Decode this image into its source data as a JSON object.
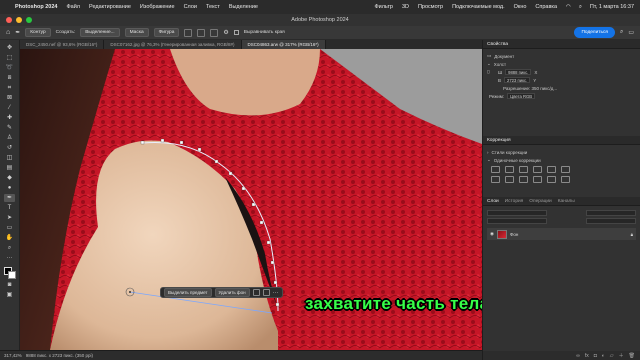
{
  "menubar": {
    "app": "Photoshop 2024",
    "items": [
      "Файл",
      "Редактирование",
      "Изображение",
      "Слои",
      "Текст",
      "Выделение",
      "Фильтр",
      "3D",
      "Просмотр",
      "Подключаемые мод.",
      "Окно",
      "Справка"
    ],
    "clock": "Пт, 1 марта  16:37"
  },
  "window": {
    "title": "Adobe Photoshop 2024"
  },
  "options": {
    "mode": "Контур",
    "make": "Создать:",
    "selection": "Выделение...",
    "mask": "Маска",
    "shape": "Фигура",
    "align": "Выравнивать края",
    "share": "Поделиться"
  },
  "tabs": [
    "DSC_2450.nef @ 93,6% (RGB/16*)",
    "DSC07162.jpg @ 76,3% (Генерированная заливка, RGB/8#)",
    "DSC04863.arw @ 317% (RGB/16*)"
  ],
  "canvas": {
    "caption": "захватите часть тела"
  },
  "context_bar": {
    "select_subject": "Выделить предмет",
    "remove_bg": "Удалить фон"
  },
  "status": {
    "zoom": "317,42%",
    "dims": "9888 пикс. x 2723 пикс. (350 ppi)"
  },
  "panel": {
    "properties": "Свойства",
    "document": "Документ",
    "canvas": "Холст",
    "w_label": "Ш",
    "w_value": "9888 пикс.",
    "h_label": "В",
    "h_value": "2723 пикс.",
    "resolution": "Разрешение: 350 пикс/д...",
    "mode_label": "Режим:",
    "mode_value": "Цвета RGB",
    "corrections": "Коррекция",
    "corr_styles": "Стили коррекции",
    "single_corr": "Одиночные коррекции",
    "layer_tabs": [
      "Слои",
      "История",
      "Операции",
      "Каналы"
    ],
    "layer_name": "Фон"
  },
  "colors": {
    "dress": "#c91828",
    "skin": "#e7c7a9",
    "caption": "#36ff48",
    "accent": "#1473e6"
  }
}
